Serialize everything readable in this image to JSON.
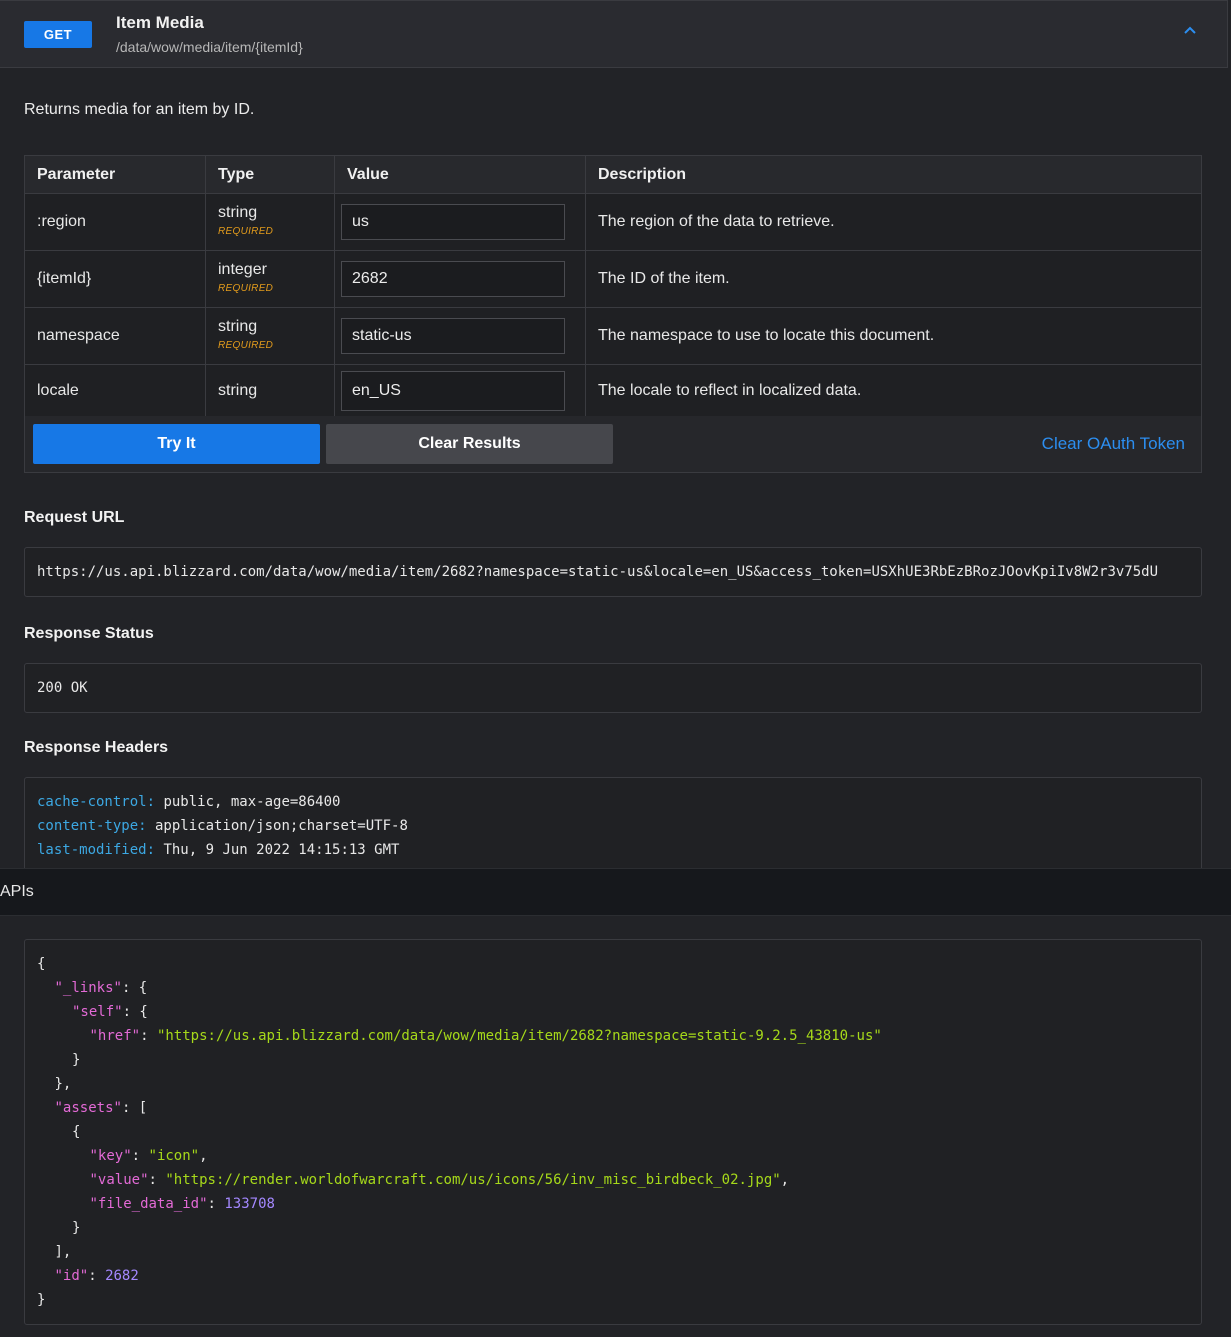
{
  "endpoint": {
    "method": "GET",
    "title": "Item Media",
    "path": "/data/wow/media/item/{itemId}",
    "description": "Returns media for an item by ID."
  },
  "params": {
    "headers": [
      "Parameter",
      "Type",
      "Value",
      "Description"
    ],
    "rows": [
      {
        "name": ":region",
        "type": "string",
        "required": "REQUIRED",
        "value": "us",
        "description": "The region of the data to retrieve."
      },
      {
        "name": "{itemId}",
        "type": "integer",
        "required": "REQUIRED",
        "value": "2682",
        "description": "The ID of the item."
      },
      {
        "name": "namespace",
        "type": "string",
        "required": "REQUIRED",
        "value": "static-us",
        "description": "The namespace to use to locate this document."
      },
      {
        "name": "locale",
        "type": "string",
        "value": "en_US",
        "description": "The locale to reflect in localized data."
      }
    ]
  },
  "actions": {
    "try_label": "Try It",
    "clear_label": "Clear Results",
    "clear_token_label": "Clear OAuth Token"
  },
  "request": {
    "heading": "Request URL",
    "url": "https://us.api.blizzard.com/data/wow/media/item/2682?namespace=static-us&locale=en_US&access_token=USXhUE3RbEzBRozJOovKpiIv8W2r3v75dU"
  },
  "status": {
    "heading": "Response Status",
    "value": "200 OK"
  },
  "headers": {
    "heading": "Response Headers",
    "items": [
      {
        "key": "cache-control:",
        "value": " public, max-age=86400"
      },
      {
        "key": "content-type:",
        "value": " application/json;charset=UTF-8"
      },
      {
        "key": "last-modified:",
        "value": " Thu, 9 Jun 2022 14:15:13 GMT"
      }
    ]
  },
  "overlay": {
    "label": "APIs"
  },
  "body": {
    "lines": [
      {
        "i": 0,
        "p": [
          "{"
        ]
      },
      {
        "i": 1,
        "p": [
          [
            "k",
            "\"_links\""
          ],
          ": {"
        ]
      },
      {
        "i": 2,
        "p": [
          [
            "k",
            "\"self\""
          ],
          ": {"
        ]
      },
      {
        "i": 3,
        "p": [
          [
            "k",
            "\"href\""
          ],
          ": ",
          [
            "s",
            "\"https://us.api.blizzard.com/data/wow/media/item/2682?namespace=static-9.2.5_43810-us\""
          ]
        ]
      },
      {
        "i": 2,
        "p": [
          "}"
        ]
      },
      {
        "i": 1,
        "p": [
          "},"
        ]
      },
      {
        "i": 1,
        "p": [
          [
            "k",
            "\"assets\""
          ],
          ": ["
        ]
      },
      {
        "i": 2,
        "p": [
          "{"
        ]
      },
      {
        "i": 3,
        "p": [
          [
            "k",
            "\"key\""
          ],
          ": ",
          [
            "s",
            "\"icon\""
          ],
          ","
        ]
      },
      {
        "i": 3,
        "p": [
          [
            "k",
            "\"value\""
          ],
          ": ",
          [
            "s",
            "\"https://render.worldofwarcraft.com/us/icons/56/inv_misc_birdbeck_02.jpg\""
          ],
          ","
        ]
      },
      {
        "i": 3,
        "p": [
          [
            "k",
            "\"file_data_id\""
          ],
          ": ",
          [
            "n",
            "133708"
          ]
        ]
      },
      {
        "i": 2,
        "p": [
          "}"
        ]
      },
      {
        "i": 1,
        "p": [
          "],"
        ]
      },
      {
        "i": 1,
        "p": [
          [
            "k",
            "\"id\""
          ],
          ": ",
          [
            "n",
            "2682"
          ]
        ]
      },
      {
        "i": 0,
        "p": [
          "}"
        ]
      }
    ]
  },
  "colors": {
    "accent": "#1778e6",
    "link": "#2c8ef0",
    "required": "#e29b1c",
    "json_key": "#e36ad6",
    "json_string": "#a6d91a",
    "json_number": "#a488ff",
    "header_key": "#3ca8e3"
  },
  "icons": {
    "collapse": "chevron-up-icon"
  }
}
